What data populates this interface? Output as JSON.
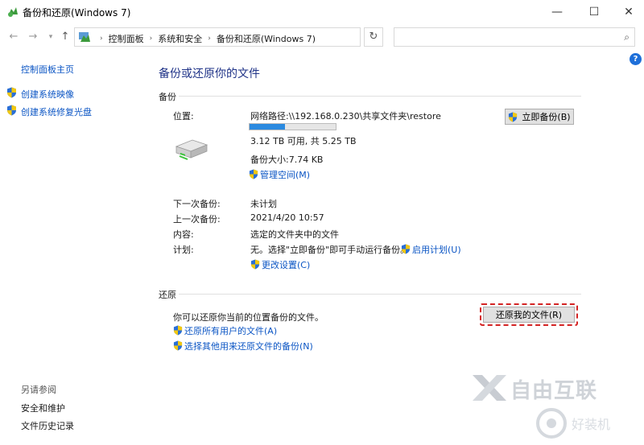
{
  "window": {
    "title": "备份和还原(Windows 7)",
    "min_glyph": "—",
    "max_glyph": "☐",
    "close_glyph": "✕"
  },
  "nav": {
    "back_glyph": "←",
    "forward_glyph": "→",
    "history_glyph": "▾",
    "up_glyph": "↑",
    "refresh_glyph": "↻",
    "dropdown_glyph": "⌄",
    "search_glyph": "⌕"
  },
  "breadcrumb": {
    "items": [
      "控制面板",
      "系统和安全",
      "备份和还原(Windows 7)"
    ],
    "separator": "›"
  },
  "search": {
    "placeholder": ""
  },
  "help": {
    "glyph": "?"
  },
  "sidebar": {
    "home": "控制面板主页",
    "items": [
      {
        "label": "创建系统映像",
        "icon": "uac-shield-icon"
      },
      {
        "label": "创建系统修复光盘",
        "icon": "uac-shield-icon"
      }
    ],
    "see_also_label": "另请参阅",
    "see_also": [
      "安全和维护",
      "文件历史记录"
    ]
  },
  "main": {
    "title": "备份或还原你的文件",
    "backup": {
      "section_label": "备份",
      "location_label": "位置:",
      "location_value": "网络路径:\\\\192.168.0.230\\共享文件夹\\restore",
      "usage_fraction": 0.41,
      "space_text": "3.12 TB 可用, 共 5.25 TB",
      "size_text": "备份大小:7.74 KB",
      "manage_space": "管理空间(M)",
      "backup_now": "立即备份(B)",
      "next_label": "下一次备份:",
      "next_value": "未计划",
      "last_label": "上一次备份:",
      "last_value": "2021/4/20 10:57",
      "contents_label": "内容:",
      "contents_value": "选定的文件夹中的文件",
      "schedule_label": "计划:",
      "schedule_value": "无。选择\"立即备份\"即可手动运行备份。",
      "enable_schedule": "启用计划(U)",
      "change_settings": "更改设置(C)"
    },
    "restore": {
      "section_label": "还原",
      "description": "你可以还原你当前的位置备份的文件。",
      "restore_button": "还原我的文件(R)",
      "restore_all": "还原所有用户的文件(A)",
      "select_other": "选择其他用来还原文件的备份(N)"
    }
  },
  "watermark": {
    "text1": "自由互联",
    "text2": "好装机"
  },
  "colors": {
    "link": "#0b55c4",
    "title": "#1e3287",
    "usage_fill": "#2b8ae0",
    "highlight": "#d42424"
  }
}
